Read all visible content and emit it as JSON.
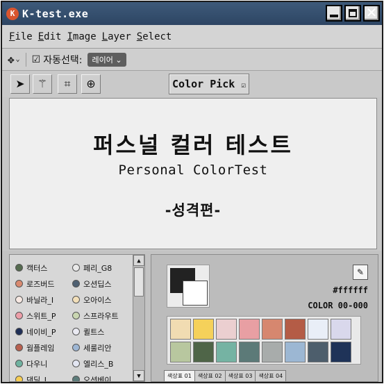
{
  "window": {
    "title": "K-test.exe",
    "logo_glyph": "K"
  },
  "menu": [
    {
      "key": "F",
      "rest": "ile"
    },
    {
      "key": "E",
      "rest": "dit"
    },
    {
      "key": "I",
      "rest": "mage"
    },
    {
      "key": "L",
      "rest": "ayer"
    },
    {
      "key": "S",
      "rest": "elect"
    }
  ],
  "options": {
    "move_glyph": "✥",
    "auto_select_label": "자동선택:",
    "auto_select_checked": "☑",
    "layer_dropdown": "레이어 ⌄"
  },
  "tools": {
    "arrow": "➤",
    "wand": "⚚",
    "crop": "⌗",
    "target": "⊕",
    "color_pick_label": "Color Pick",
    "color_pick_check": "☑"
  },
  "canvas": {
    "title": "퍼스널 컬러 테스트",
    "subtitle": "Personal ColorTest",
    "tag": "-성격편-"
  },
  "list": {
    "left": [
      {
        "label": "캑터스",
        "color": "#556b4f"
      },
      {
        "label": "로즈버드",
        "color": "#d98a70"
      },
      {
        "label": "바닐라_I",
        "color": "#f7e9e3"
      },
      {
        "label": "스위트_P",
        "color": "#ec9ea8"
      },
      {
        "label": "네이비_P",
        "color": "#1f2f57"
      },
      {
        "label": "웜플레임",
        "color": "#b8604f"
      },
      {
        "label": "다우니",
        "color": "#6fb2a0"
      },
      {
        "label": "댄딜_L",
        "color": "#f6cd52"
      }
    ],
    "right": [
      {
        "label": "페리_G8",
        "color": "#e9e9e9"
      },
      {
        "label": "오션딥스",
        "color": "#4e6072"
      },
      {
        "label": "오아이스",
        "color": "#f2dfb9"
      },
      {
        "label": "스프라우트",
        "color": "#c9d6b1"
      },
      {
        "label": "퀼트스",
        "color": "#eaeaf2"
      },
      {
        "label": "세룰리안",
        "color": "#9db6d4"
      },
      {
        "label": "엘리스_B",
        "color": "#e3e6f2"
      },
      {
        "label": "오션베이",
        "color": "#5c7c7a"
      }
    ]
  },
  "palette": {
    "hex": "#ffffff",
    "color_code": "COLOR 00-000",
    "eyedropper_glyph": "✎",
    "chips": [
      "#f1dcb2",
      "#f5d15a",
      "#ebcfd0",
      "#e89fa3",
      "#d6876f",
      "#b45c46",
      "#e9eef7",
      "#d9d8ec",
      "#b8c79f",
      "#4f6548",
      "#75b3a3",
      "#5c7a78",
      "#a8acab",
      "#9cb7d3",
      "#4d5e6c",
      "#1f3358"
    ],
    "tabs": [
      "색상표 01",
      "색상표 02",
      "색상표 03",
      "색상표 04"
    ]
  }
}
